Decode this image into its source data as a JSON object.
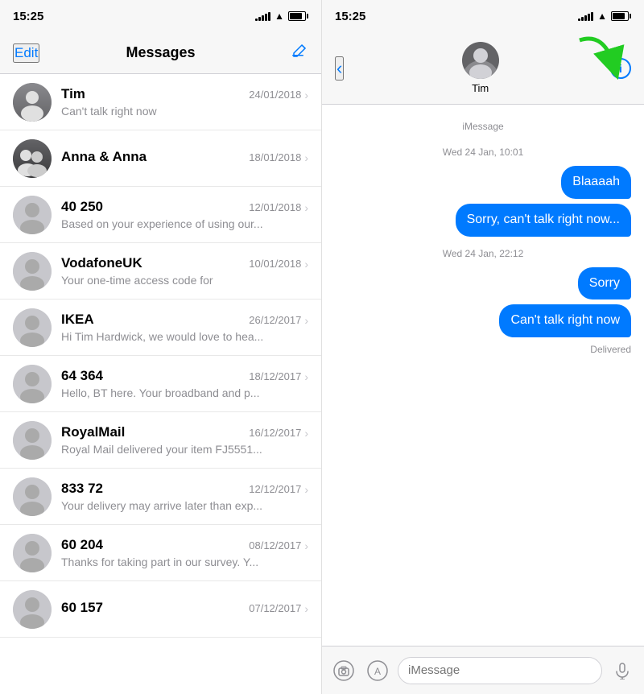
{
  "app": {
    "title": "Messages"
  },
  "left_panel": {
    "status_bar": {
      "time": "15:25"
    },
    "header": {
      "edit_label": "Edit",
      "title": "Messages",
      "compose_icon": "compose"
    },
    "conversations": [
      {
        "id": "tim",
        "name": "Tim",
        "preview": "Can't talk right now",
        "date": "24/01/2018",
        "avatar_type": "tim"
      },
      {
        "id": "anna",
        "name": "Anna & Anna",
        "preview": "",
        "date": "18/01/2018",
        "avatar_type": "anna"
      },
      {
        "id": "40250",
        "name": "40 250",
        "preview": "Based on your experience of using our...",
        "date": "12/01/2018",
        "avatar_type": "generic"
      },
      {
        "id": "vodafone",
        "name": "VodafoneUK",
        "preview": "Your one-time access code for",
        "date": "10/01/2018",
        "avatar_type": "generic"
      },
      {
        "id": "ikea",
        "name": "IKEA",
        "preview": "Hi Tim Hardwick, we would love to hea...",
        "date": "26/12/2017",
        "avatar_type": "generic"
      },
      {
        "id": "64364",
        "name": "64 364",
        "preview": "Hello, BT here. Your broadband and p...",
        "date": "18/12/2017",
        "avatar_type": "generic"
      },
      {
        "id": "royalmail",
        "name": "RoyalMail",
        "preview": "Royal Mail delivered your item FJ5551...",
        "date": "16/12/2017",
        "avatar_type": "generic"
      },
      {
        "id": "83372",
        "name": "833 72",
        "preview": "Your delivery may arrive later than exp...",
        "date": "12/12/2017",
        "avatar_type": "generic"
      },
      {
        "id": "60204",
        "name": "60 204",
        "preview": "Thanks for taking part in our survey. Y...",
        "date": "08/12/2017",
        "avatar_type": "generic"
      },
      {
        "id": "60157",
        "name": "60 157",
        "preview": "",
        "date": "07/12/2017",
        "avatar_type": "generic"
      }
    ]
  },
  "right_panel": {
    "status_bar": {
      "time": "15:25"
    },
    "chat_header": {
      "contact_name": "Tim",
      "back_label": "‹",
      "info_label": "i"
    },
    "messages": [
      {
        "type": "label",
        "text": "iMessage"
      },
      {
        "type": "label",
        "text": "Wed 24 Jan, 10:01"
      },
      {
        "type": "sent",
        "text": "Blaaaah"
      },
      {
        "type": "sent",
        "text": "Sorry, can't talk right now..."
      },
      {
        "type": "label",
        "text": "Wed 24 Jan, 22:12"
      },
      {
        "type": "sent",
        "text": "Sorry"
      },
      {
        "type": "sent",
        "text": "Can't talk right now"
      },
      {
        "type": "delivered",
        "text": "Delivered"
      }
    ],
    "input_bar": {
      "placeholder": "iMessage",
      "camera_icon": "camera",
      "apps_icon": "apps",
      "mic_icon": "mic"
    }
  }
}
